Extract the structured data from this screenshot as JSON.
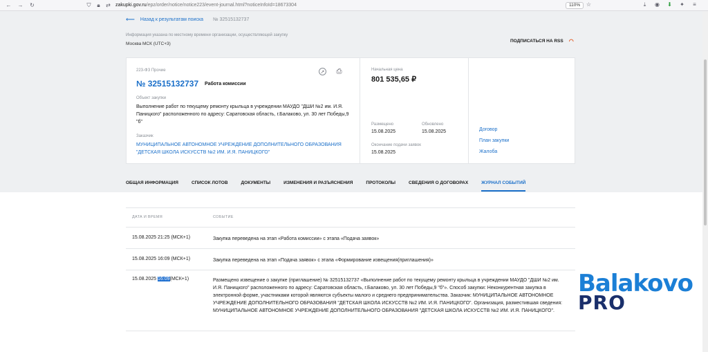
{
  "browser": {
    "url_domain": "zakupki.gov.ru",
    "url_path": "/epz/order/notice/notice223/event-journal.html?noticeInfoId=18673304",
    "zoom": "110%"
  },
  "header": {
    "back_label": "Назад к результатам поиска",
    "notice_num": "№ 32515132737",
    "info_note": "Информация указана по местному времени организации, осуществляющей закупку",
    "timezone": "Москва МСК (UTC+3)",
    "rss_label": "ПОДПИСАТЬСЯ НА RSS"
  },
  "card": {
    "law": "223-ФЗ Прочие",
    "reg_number": "№ 32515132737",
    "stage": "Работа комиссии",
    "object_label": "Объект закупки",
    "object_text": "Выполнение работ по текущему ремонту крыльца в учреждении МАУДО \"ДШИ №2 им. И.Я. Паницкого\" расположенного по адресу: Саратовская область, г.Балаково, ул. 30 лет Победы,9 \"б\"",
    "customer_label": "Заказчик",
    "customer_text": "МУНИЦИПАЛЬНОЕ АВТОНОМНОЕ УЧРЕЖДЕНИЕ ДОПОЛНИТЕЛЬНОГО ОБРАЗОВАНИЯ \"ДЕТСКАЯ ШКОЛА ИСКУССТВ №2 ИМ. И.Я. ПАНИЦКОГО\"",
    "price_label": "Начальная цена",
    "price": "801 535,65 ₽",
    "posted_label": "Размещено",
    "posted": "15.08.2025",
    "updated_label": "Обновлено",
    "updated": "15.08.2025",
    "end_label": "Окончание подачи заявок",
    "end": "15.08.2025",
    "links": [
      "Договор",
      "План закупки",
      "Жалоба"
    ]
  },
  "tabs": [
    "ОБЩАЯ ИНФОРМАЦИЯ",
    "СПИСОК ЛОТОВ",
    "ДОКУМЕНТЫ",
    "ИЗМЕНЕНИЯ И РАЗЪЯСНЕНИЯ",
    "ПРОТОКОЛЫ",
    "СВЕДЕНИЯ О ДОГОВОРАХ",
    "ЖУРНАЛ СОБЫТИЙ"
  ],
  "journal": {
    "col_date": "ДАТА И ВРЕМЯ",
    "col_event": "СОБЫТИЕ",
    "rows": [
      {
        "date": "15.08.2025 21:25 (МСК+1)",
        "event": "Закупка переведена на этап «Работа комиссии» с этапа «Подача заявок»"
      },
      {
        "date": "15.08.2025 16:09 (МСК+1)",
        "event": "Закупка переведена на этап «Подача заявок» с этапа «Формирование извещения(приглашения)»"
      },
      {
        "date_prefix": "15.08.2025 ",
        "date_highlight": "16:09",
        "date_suffix": "(МСК+1)",
        "event": "Размещено извещение о закупке (приглашение) № 32515132737 «Выполнение работ по текущему ремонту крыльца в учреждении МАУДО \"ДШИ №2 им. И.Я. Паницкого\" расположенного по адресу: Саратовская область, г.Балаково, ул. 30 лет Победы,9 \"б\"». Способ закупки: Неконкурентная закупка в электронной форме, участниками которой являются субъекты малого и среднего предпринимательства. Заказчик: МУНИЦИПАЛЬНОЕ АВТОНОМНОЕ УЧРЕЖДЕНИЕ ДОПОЛНИТЕЛЬНОГО ОБРАЗОВАНИЯ \"ДЕТСКАЯ ШКОЛА ИСКУССТВ №2 ИМ. И.Я. ПАНИЦКОГО\". Организация, разместившая сведения: МУНИЦИПАЛЬНОЕ АВТОНОМНОЕ УЧРЕЖДЕНИЕ ДОПОЛНИТЕЛЬНОГО ОБРАЗОВАНИЯ \"ДЕТСКАЯ ШКОЛА ИСКУССТВ №2 ИМ. И.Я. ПАНИЦКОГО\"."
      }
    ]
  },
  "watermark": {
    "line1": "Balakovo",
    "line2": "PRO"
  }
}
